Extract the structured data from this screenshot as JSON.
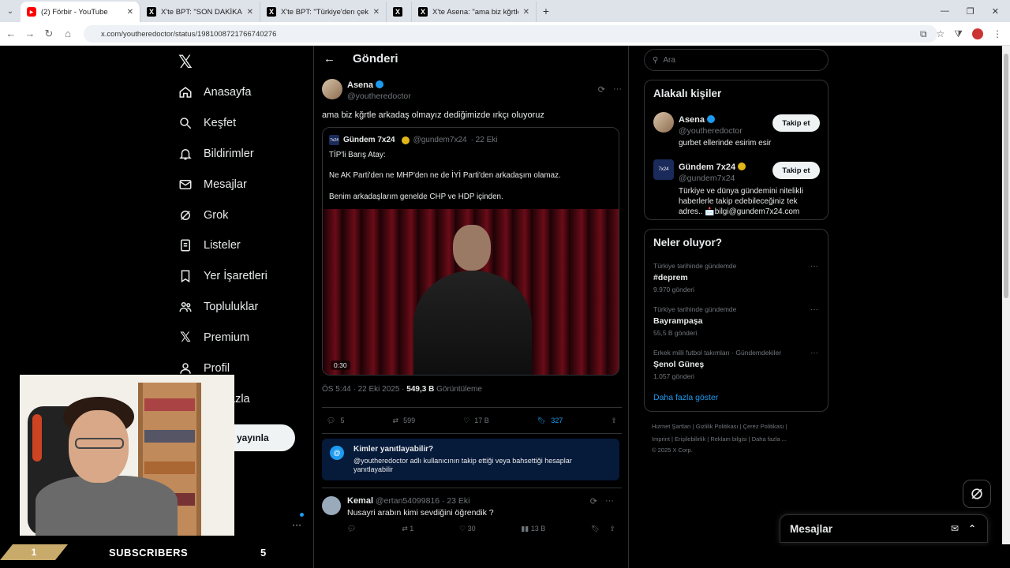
{
  "browser": {
    "tabs": [
      {
        "title": "(2) Förbir - YouTube",
        "favicon": "youtube-icon",
        "active": true
      },
      {
        "title": "X'te BPT: \"SON DAKİKA | Terör ö",
        "favicon": "x-icon",
        "active": false
      },
      {
        "title": "X'te BPT: \"Türkiye'den çekilen P",
        "favicon": "x-icon",
        "active": false
      },
      {
        "title": "",
        "favicon": "x-icon",
        "active": false
      },
      {
        "title": "X'te Asena: \"ama biz kğrtle arka",
        "favicon": "x-icon",
        "active": false
      }
    ],
    "url": "x.com/youtheredoctor/status/1981008721766740276"
  },
  "sidebar": {
    "items": [
      {
        "label": "Anasayfa",
        "icon": "home-icon"
      },
      {
        "label": "Keşfet",
        "icon": "search-icon"
      },
      {
        "label": "Bildirimler",
        "icon": "bell-icon"
      },
      {
        "label": "Mesajlar",
        "icon": "mail-icon"
      },
      {
        "label": "Grok",
        "icon": "grok-icon"
      },
      {
        "label": "Listeler",
        "icon": "list-icon"
      },
      {
        "label": "Yer İşaretleri",
        "icon": "bookmark-icon"
      },
      {
        "label": "Topluluklar",
        "icon": "communities-icon"
      },
      {
        "label": "Premium",
        "icon": "x-premium-icon"
      },
      {
        "label": "Profil",
        "icon": "profile-icon"
      },
      {
        "label": "azla",
        "icon": "more-icon"
      }
    ],
    "publish_label": "yayınla"
  },
  "post": {
    "header_title": "Gönderi",
    "author_name": "Asena",
    "author_handle": "@youtheredoctor",
    "text": "ama biz kğrtle arkadaş olmayız dediğimizde ırkçı oluyoruz",
    "quote": {
      "name": "Gündem 7x24",
      "handle": "@gundem7x24",
      "date": "· 22 Eki",
      "line1": "TİP'li Barış Atay:",
      "line2": "Ne AK Parti'den ne MHP'den ne de İYİ Parti'den arkadaşım olamaz.",
      "line3": "Benim arkadaşlarım genelde CHP ve HDP içinden.",
      "video_time": "0:30"
    },
    "meta_time": "ÖS 5:44 · 22 Eki 2025 ·",
    "views": "549,3 B",
    "views_label": "Görüntüleme",
    "replies": "5",
    "reposts": "599",
    "likes": "17 B",
    "bookmarks": "327",
    "who_can_reply_title": "Kimler yanıtlayabilir?",
    "who_can_reply_desc": "@youtheredoctor adlı kullanıcının takip ettiği veya bahsettiği hesaplar yanıtlayabilir"
  },
  "comment": {
    "name": "Kemal",
    "handle": "@ertan54099816",
    "date": "· 23 Eki",
    "text": "Nusayri arabın kimi sevdiğini öğrendik ?",
    "replies": "",
    "reposts": "1",
    "likes": "30",
    "views": "13 B"
  },
  "right": {
    "search_placeholder": "Ara",
    "related_title": "Alakalı kişiler",
    "people": [
      {
        "name": "Asena",
        "handle": "@youtheredoctor",
        "bio": "gurbet ellerinde esirim esir",
        "follow": "Takip et"
      },
      {
        "name": "Gündem 7x24",
        "handle": "@gundem7x24",
        "bio": "Türkiye ve dünya gündemini nitelikli haberlerle takip edebileceğiniz tek adres.. 📩bilgi@gundem7x24.com",
        "follow": "Takip et"
      }
    ],
    "trending_title": "Neler oluyor?",
    "trends": [
      {
        "context": "Türkiye tarihinde gündemde",
        "name": "#deprem",
        "count": "9.970 gönderi"
      },
      {
        "context": "Türkiye tarihinde gündemde",
        "name": "Bayrampaşa",
        "count": "55,5 B gönderi"
      },
      {
        "context": "Erkek milli futbol takımları · Gündemdekiler",
        "name": "Şenol Güneş",
        "count": "1.057 gönderi"
      }
    ],
    "show_more": "Daha fazla göster",
    "footer_line1": "Hizmet Şartları  |  Gizlilik Politikası  |  Çerez Politikası  |",
    "footer_line2": "Imprint  |  Erişilebilirlik  |  Reklam bilgisi  |  Daha fazla ...",
    "footer_line3": "© 2025 X Corp."
  },
  "messages_bar": {
    "label": "Mesajlar"
  },
  "overlay": {
    "sub_number": "1",
    "sub_label": "SUBSCRIBERS",
    "sub_count": "5"
  }
}
